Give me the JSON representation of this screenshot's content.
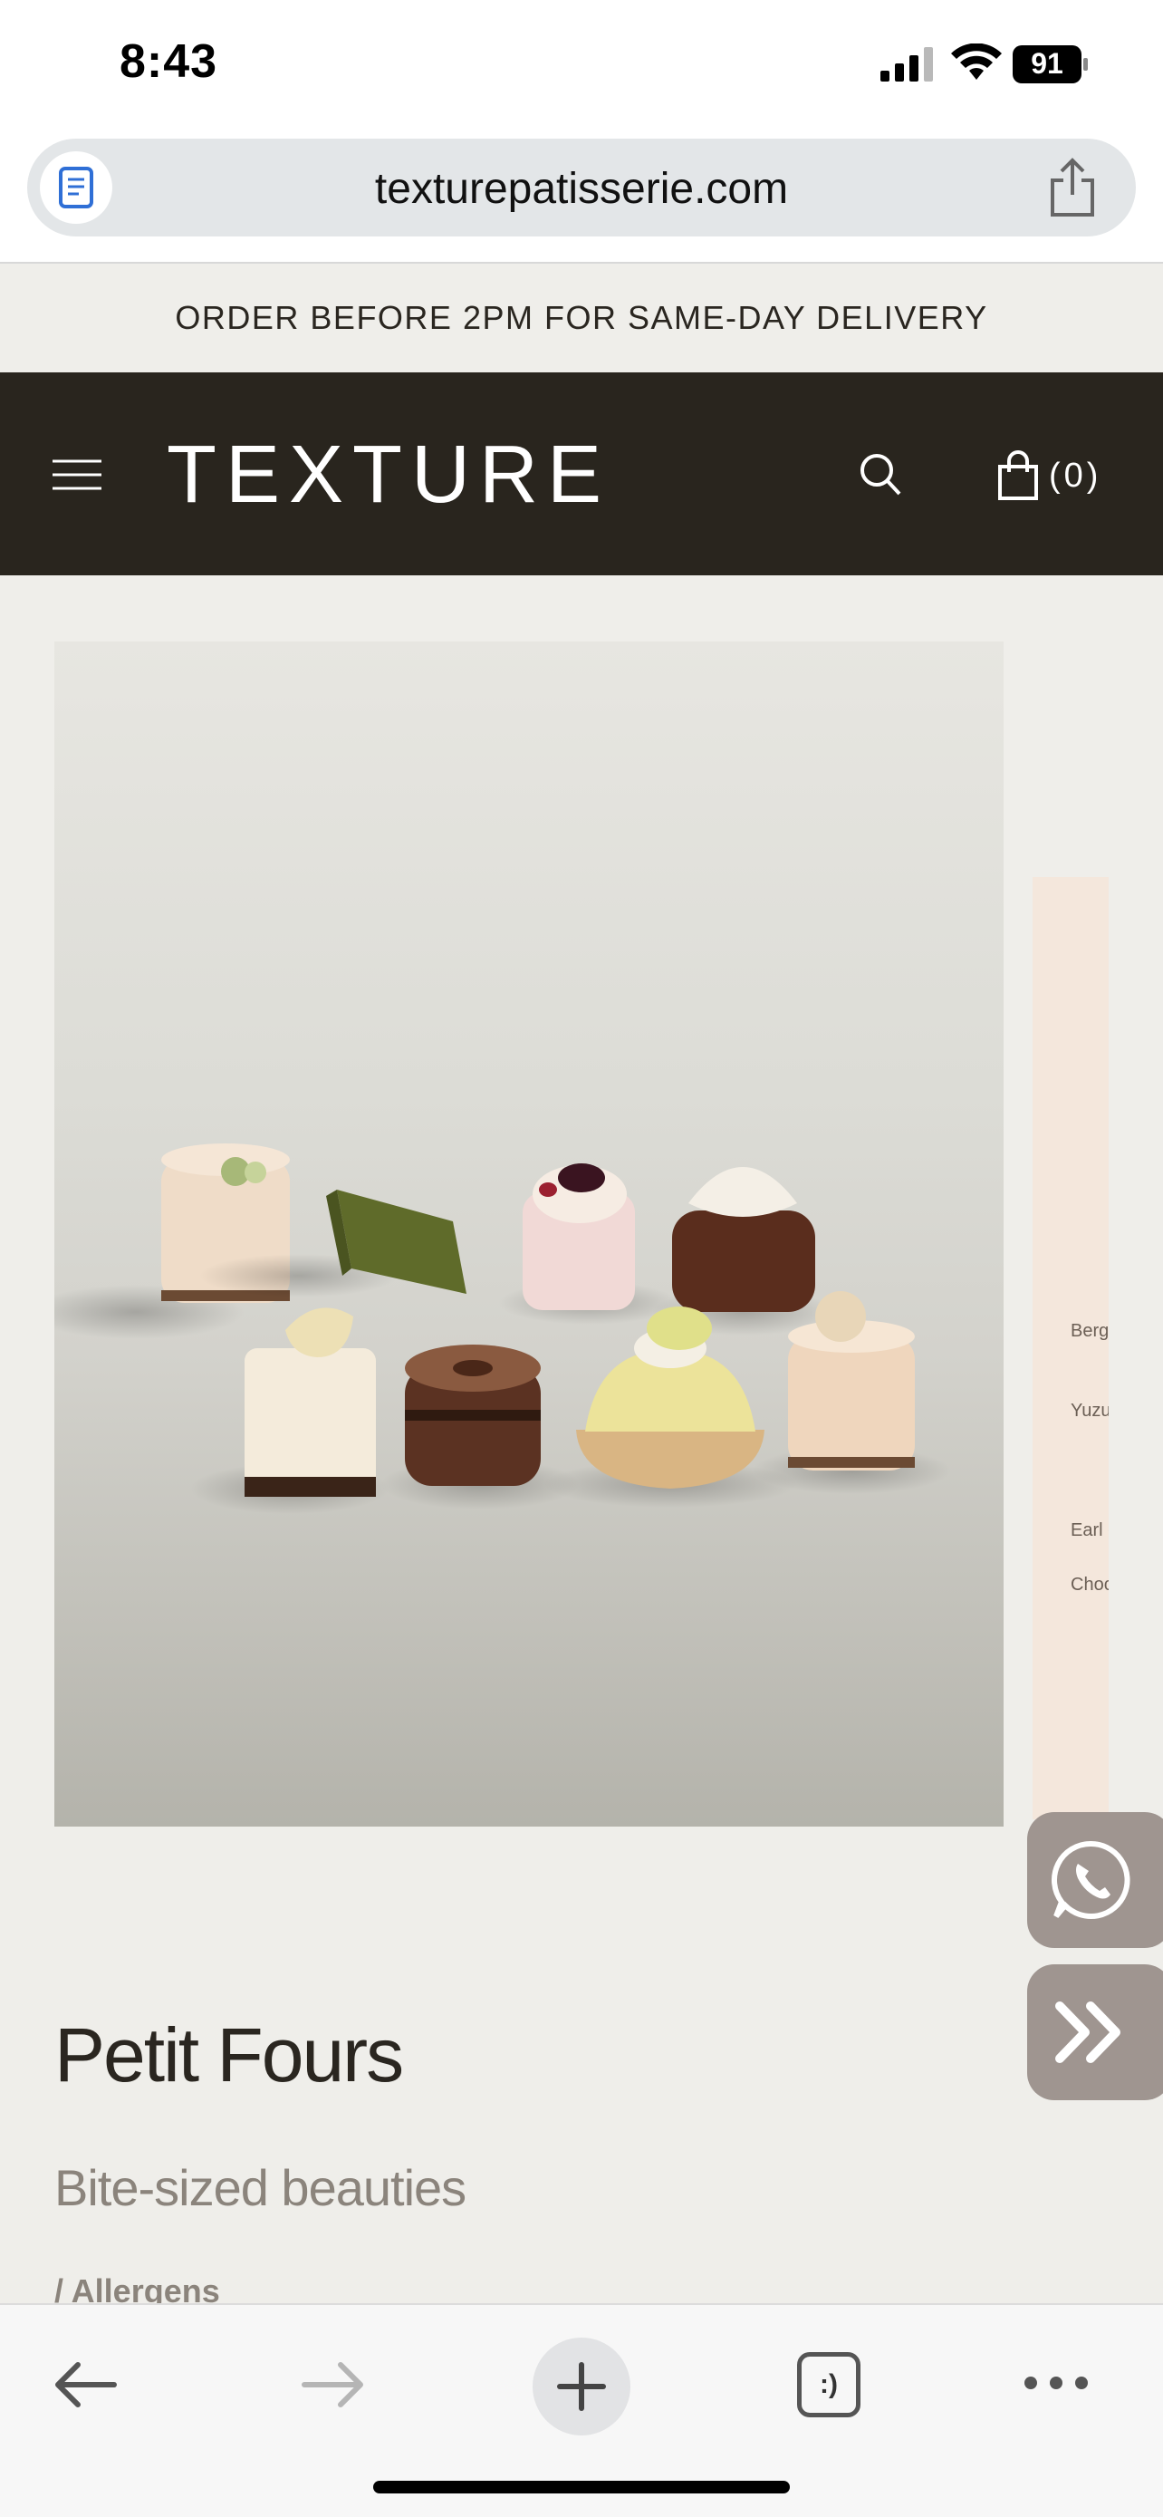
{
  "status_bar": {
    "time": "8:43",
    "battery": "91"
  },
  "browser": {
    "url": "texturepatisserie.com"
  },
  "announcement": "ORDER BEFORE 2PM FOR SAME-DAY DELIVERY",
  "header": {
    "logo": "TEXTURE",
    "cart_count": "(0)"
  },
  "side_panel": {
    "lines": [
      "Berg",
      "Yuzu",
      "Earl g",
      "Choc"
    ]
  },
  "product": {
    "title": "Petit Fours",
    "subtitle": "Bite-sized beauties",
    "allergens_label": "/ Allergens"
  },
  "toolbar": {
    "tabs_label": ":)"
  }
}
